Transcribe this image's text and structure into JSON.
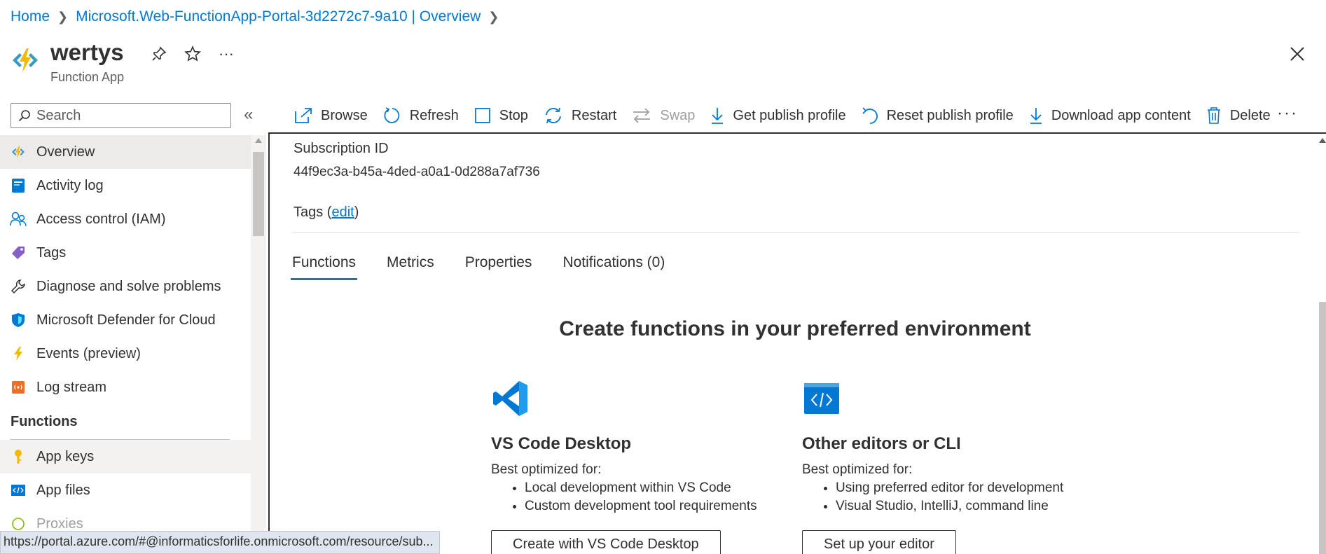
{
  "breadcrumb": {
    "home": "Home",
    "resource": "Microsoft.Web-FunctionApp-Portal-3d2272c7-9a10 | Overview"
  },
  "header": {
    "title": "wertys",
    "subtitle": "Function App",
    "icon": "function-app-icon",
    "pin_icon": "pin-icon",
    "favorite_icon": "star-icon",
    "more_label": "···"
  },
  "search": {
    "placeholder": "Search",
    "value": ""
  },
  "collapse_label": "«",
  "toolbar": {
    "browse": "Browse",
    "refresh": "Refresh",
    "stop": "Stop",
    "restart": "Restart",
    "swap": "Swap",
    "get_publish_profile": "Get publish profile",
    "reset_publish_profile": "Reset publish profile",
    "download_app_content": "Download app content",
    "delete": "Delete",
    "more": "···"
  },
  "sidebar": {
    "items": [
      {
        "label": "Overview",
        "icon": "function-app-icon"
      },
      {
        "label": "Activity log",
        "icon": "activity-log-icon"
      },
      {
        "label": "Access control (IAM)",
        "icon": "people-icon"
      },
      {
        "label": "Tags",
        "icon": "tag-icon"
      },
      {
        "label": "Diagnose and solve problems",
        "icon": "wrench-icon"
      },
      {
        "label": "Microsoft Defender for Cloud",
        "icon": "shield-icon"
      },
      {
        "label": "Events (preview)",
        "icon": "lightning-icon"
      },
      {
        "label": "Log stream",
        "icon": "log-stream-icon"
      }
    ],
    "group_functions": "Functions",
    "functions_items": [
      {
        "label": "App keys",
        "icon": "key-icon"
      },
      {
        "label": "App files",
        "icon": "code-file-icon"
      },
      {
        "label": "Proxies",
        "icon": "proxy-icon"
      }
    ]
  },
  "status_url": "https://portal.azure.com/#@informaticsforlife.onmicrosoft.com/resource/sub...",
  "main": {
    "subscription_label": "Subscription ID",
    "subscription_value": "44f9ec3a-b45a-4ded-a0a1-0d288a7af736",
    "tags_label": "Tags (",
    "tags_edit": "edit",
    "tags_close": ")",
    "tabs": [
      "Functions",
      "Metrics",
      "Properties",
      "Notifications (0)"
    ],
    "heading": "Create functions in your preferred environment",
    "cards": [
      {
        "icon": "vscode-icon",
        "title": "VS Code Desktop",
        "sub": "Best optimized for:",
        "bullets": [
          "Local development within VS Code",
          "Custom development tool requirements"
        ],
        "button": "Create with VS Code Desktop"
      },
      {
        "icon": "code-editor-icon",
        "title": "Other editors or CLI",
        "sub": "Best optimized for:",
        "bullets": [
          "Using preferred editor for development",
          "Visual Studio, IntelliJ, command line"
        ],
        "button": "Set up your editor"
      }
    ]
  },
  "colors": {
    "accent": "#0078d4",
    "function_yellow": "#f2b900",
    "text": "#323130"
  }
}
